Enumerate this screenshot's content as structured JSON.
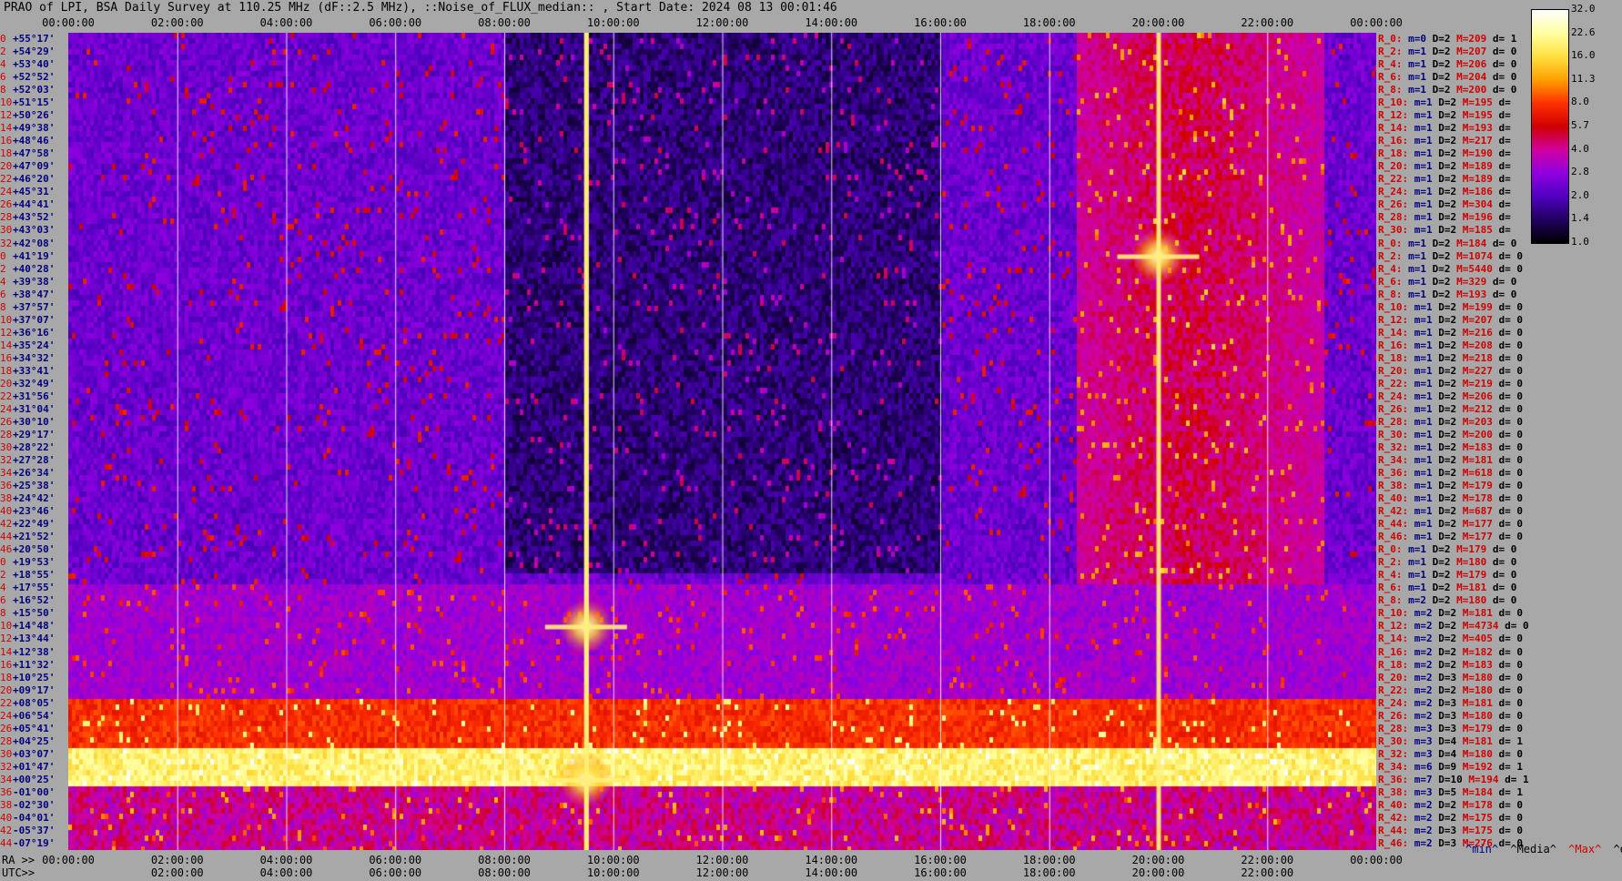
{
  "title": "PRAO of LPI, BSA Daily Survey at 110.25 MHz (dF::2.5 MHz), ::Noise_of_FLUX_median:: , Start Date: 2024 08 13 00:01:46",
  "top_axis_labels": [
    "00:00:00",
    "02:00:00",
    "04:00:00",
    "06:00:00",
    "08:00:00",
    "10:00:00",
    "12:00:00",
    "14:00:00",
    "16:00:00",
    "18:00:00",
    "20:00:00",
    "22:00:00",
    "00:00:00"
  ],
  "bottom_axis_ra_label": "RA >>",
  "bottom_axis_ra_labels": [
    "00:00:00",
    "02:00:00",
    "04:00:00",
    "06:00:00",
    "08:00:00",
    "10:00:00",
    "12:00:00",
    "14:00:00",
    "16:00:00",
    "18:00:00",
    "20:00:00",
    "22:00:00",
    "00:00:00"
  ],
  "bottom_axis_utc_label": "UTC>>",
  "bottom_axis_utc_labels": [
    "02:00:00",
    "04:00:00",
    "06:00:00",
    "08:00:00",
    "10:00:00",
    "12:00:00",
    "14:00:00",
    "16:00:00",
    "18:00:00",
    "20:00:00",
    "22:00:00"
  ],
  "stat_headers": [
    "^min^",
    "^Media^",
    "^Max^",
    "^devia^"
  ],
  "colorbar": {
    "ticks": [
      "32.0",
      "22.6",
      "16.0",
      "11.3",
      "8.0",
      "5.7",
      "4.0",
      "2.8",
      "2.0",
      "1.4",
      "1.0"
    ],
    "colors": [
      "#ffffff",
      "#ffffa0",
      "#ffe040",
      "#ffa000",
      "#ff3000",
      "#d00000",
      "#d000a0",
      "#9000e0",
      "#5000c0",
      "#200060",
      "#000000"
    ]
  },
  "row_labels": [
    {
      "i": "0",
      "dec": "+55°17'"
    },
    {
      "i": "2",
      "dec": "+54°29'"
    },
    {
      "i": "4",
      "dec": "+53°40'"
    },
    {
      "i": "6",
      "dec": "+52°52'"
    },
    {
      "i": "8",
      "dec": "+52°03'"
    },
    {
      "i": "10",
      "dec": "+51°15'"
    },
    {
      "i": "12",
      "dec": "+50°26'"
    },
    {
      "i": "14",
      "dec": "+49°38'"
    },
    {
      "i": "16",
      "dec": "+48°46'"
    },
    {
      "i": "18",
      "dec": "+47°58'"
    },
    {
      "i": "20",
      "dec": "+47°09'"
    },
    {
      "i": "22",
      "dec": "+46°20'"
    },
    {
      "i": "24",
      "dec": "+45°31'"
    },
    {
      "i": "26",
      "dec": "+44°41'"
    },
    {
      "i": "28",
      "dec": "+43°52'"
    },
    {
      "i": "30",
      "dec": "+43°03'"
    },
    {
      "i": "32",
      "dec": "+42°08'"
    },
    {
      "i": "0",
      "dec": "+41°19'"
    },
    {
      "i": "2",
      "dec": "+40°28'"
    },
    {
      "i": "4",
      "dec": "+39°38'"
    },
    {
      "i": "6",
      "dec": "+38°47'"
    },
    {
      "i": "8",
      "dec": "+37°57'"
    },
    {
      "i": "10",
      "dec": "+37°07'"
    },
    {
      "i": "12",
      "dec": "+36°16'"
    },
    {
      "i": "14",
      "dec": "+35°24'"
    },
    {
      "i": "16",
      "dec": "+34°32'"
    },
    {
      "i": "18",
      "dec": "+33°41'"
    },
    {
      "i": "20",
      "dec": "+32°49'"
    },
    {
      "i": "22",
      "dec": "+31°56'"
    },
    {
      "i": "24",
      "dec": "+31°04'"
    },
    {
      "i": "26",
      "dec": "+30°10'"
    },
    {
      "i": "28",
      "dec": "+29°17'"
    },
    {
      "i": "30",
      "dec": "+28°22'"
    },
    {
      "i": "32",
      "dec": "+27°28'"
    },
    {
      "i": "34",
      "dec": "+26°34'"
    },
    {
      "i": "36",
      "dec": "+25°38'"
    },
    {
      "i": "38",
      "dec": "+24°42'"
    },
    {
      "i": "40",
      "dec": "+23°46'"
    },
    {
      "i": "42",
      "dec": "+22°49'"
    },
    {
      "i": "44",
      "dec": "+21°52'"
    },
    {
      "i": "46",
      "dec": "+20°50'"
    },
    {
      "i": "0",
      "dec": "+19°53'"
    },
    {
      "i": "2",
      "dec": "+18°55'"
    },
    {
      "i": "4",
      "dec": "+17°55'"
    },
    {
      "i": "6",
      "dec": "+16°52'"
    },
    {
      "i": "8",
      "dec": "+15°50'"
    },
    {
      "i": "10",
      "dec": "+14°48'"
    },
    {
      "i": "12",
      "dec": "+13°44'"
    },
    {
      "i": "14",
      "dec": "+12°38'"
    },
    {
      "i": "16",
      "dec": "+11°32'"
    },
    {
      "i": "18",
      "dec": "+10°25'"
    },
    {
      "i": "20",
      "dec": "+09°17'"
    },
    {
      "i": "22",
      "dec": "+08°05'"
    },
    {
      "i": "24",
      "dec": "+06°54'"
    },
    {
      "i": "26",
      "dec": "+05°41'"
    },
    {
      "i": "28",
      "dec": "+04°25'"
    },
    {
      "i": "30",
      "dec": "+03°07'"
    },
    {
      "i": "32",
      "dec": "+01°47'"
    },
    {
      "i": "34",
      "dec": "+00°25'"
    },
    {
      "i": "36",
      "dec": "-01°00'"
    },
    {
      "i": "38",
      "dec": "-02°30'"
    },
    {
      "i": "40",
      "dec": "-04°01'"
    },
    {
      "i": "42",
      "dec": "-05°37'"
    },
    {
      "i": "44",
      "dec": "-07°19'"
    }
  ],
  "right_stats": [
    {
      "r": "R_0:",
      "m": "m=0",
      "D": "D=2",
      "M": "M=209",
      "d": "d= 1"
    },
    {
      "r": "R_2:",
      "m": "m=1",
      "D": "D=2",
      "M": "M=207",
      "d": "d= 0"
    },
    {
      "r": "R_4:",
      "m": "m=1",
      "D": "D=2",
      "M": "M=206",
      "d": "d= 0"
    },
    {
      "r": "R_6:",
      "m": "m=1",
      "D": "D=2",
      "M": "M=204",
      "d": "d= 0"
    },
    {
      "r": "R_8:",
      "m": "m=1",
      "D": "D=2",
      "M": "M=200",
      "d": "d= 0"
    },
    {
      "r": "R_10:",
      "m": "m=1",
      "D": "D=2",
      "M": "M=195",
      "d": "d="
    },
    {
      "r": "R_12:",
      "m": "m=1",
      "D": "D=2",
      "M": "M=195",
      "d": "d="
    },
    {
      "r": "R_14:",
      "m": "m=1",
      "D": "D=2",
      "M": "M=193",
      "d": "d="
    },
    {
      "r": "R_16:",
      "m": "m=1",
      "D": "D=2",
      "M": "M=217",
      "d": "d="
    },
    {
      "r": "R_18:",
      "m": "m=1",
      "D": "D=2",
      "M": "M=190",
      "d": "d="
    },
    {
      "r": "R_20:",
      "m": "m=1",
      "D": "D=2",
      "M": "M=189",
      "d": "d="
    },
    {
      "r": "R_22:",
      "m": "m=1",
      "D": "D=2",
      "M": "M=189",
      "d": "d="
    },
    {
      "r": "R_24:",
      "m": "m=1",
      "D": "D=2",
      "M": "M=186",
      "d": "d="
    },
    {
      "r": "R_26:",
      "m": "m=1",
      "D": "D=2",
      "M": "M=304",
      "d": "d="
    },
    {
      "r": "R_28:",
      "m": "m=1",
      "D": "D=2",
      "M": "M=196",
      "d": "d="
    },
    {
      "r": "R_30:",
      "m": "m=1",
      "D": "D=2",
      "M": "M=185",
      "d": "d="
    },
    {
      "r": "R_0:",
      "m": "m=1",
      "D": "D=2",
      "M": "M=184",
      "d": "d= 0"
    },
    {
      "r": "R_2:",
      "m": "m=1",
      "D": "D=2",
      "M": "M=1074",
      "d": "d= 0"
    },
    {
      "r": "R_4:",
      "m": "m=1",
      "D": "D=2",
      "M": "M=5440",
      "d": "d= 0"
    },
    {
      "r": "R_6:",
      "m": "m=1",
      "D": "D=2",
      "M": "M=329",
      "d": "d= 0"
    },
    {
      "r": "R_8:",
      "m": "m=1",
      "D": "D=2",
      "M": "M=193",
      "d": "d= 0"
    },
    {
      "r": "R_10:",
      "m": "m=1",
      "D": "D=2",
      "M": "M=199",
      "d": "d= 0"
    },
    {
      "r": "R_12:",
      "m": "m=1",
      "D": "D=2",
      "M": "M=207",
      "d": "d= 0"
    },
    {
      "r": "R_14:",
      "m": "m=1",
      "D": "D=2",
      "M": "M=216",
      "d": "d= 0"
    },
    {
      "r": "R_16:",
      "m": "m=1",
      "D": "D=2",
      "M": "M=208",
      "d": "d= 0"
    },
    {
      "r": "R_18:",
      "m": "m=1",
      "D": "D=2",
      "M": "M=218",
      "d": "d= 0"
    },
    {
      "r": "R_20:",
      "m": "m=1",
      "D": "D=2",
      "M": "M=227",
      "d": "d= 0"
    },
    {
      "r": "R_22:",
      "m": "m=1",
      "D": "D=2",
      "M": "M=219",
      "d": "d= 0"
    },
    {
      "r": "R_24:",
      "m": "m=1",
      "D": "D=2",
      "M": "M=206",
      "d": "d= 0"
    },
    {
      "r": "R_26:",
      "m": "m=1",
      "D": "D=2",
      "M": "M=212",
      "d": "d= 0"
    },
    {
      "r": "R_28:",
      "m": "m=1",
      "D": "D=2",
      "M": "M=203",
      "d": "d= 0"
    },
    {
      "r": "R_30:",
      "m": "m=1",
      "D": "D=2",
      "M": "M=200",
      "d": "d= 0"
    },
    {
      "r": "R_32:",
      "m": "m=1",
      "D": "D=2",
      "M": "M=183",
      "d": "d= 0"
    },
    {
      "r": "R_34:",
      "m": "m=1",
      "D": "D=2",
      "M": "M=181",
      "d": "d= 0"
    },
    {
      "r": "R_36:",
      "m": "m=1",
      "D": "D=2",
      "M": "M=618",
      "d": "d= 0"
    },
    {
      "r": "R_38:",
      "m": "m=1",
      "D": "D=2",
      "M": "M=179",
      "d": "d= 0"
    },
    {
      "r": "R_40:",
      "m": "m=1",
      "D": "D=2",
      "M": "M=178",
      "d": "d= 0"
    },
    {
      "r": "R_42:",
      "m": "m=1",
      "D": "D=2",
      "M": "M=687",
      "d": "d= 0"
    },
    {
      "r": "R_44:",
      "m": "m=1",
      "D": "D=2",
      "M": "M=177",
      "d": "d= 0"
    },
    {
      "r": "R_46:",
      "m": "m=1",
      "D": "D=2",
      "M": "M=177",
      "d": "d= 0"
    },
    {
      "r": "R_0:",
      "m": "m=1",
      "D": "D=2",
      "M": "M=179",
      "d": "d= 0"
    },
    {
      "r": "R_2:",
      "m": "m=1",
      "D": "D=2",
      "M": "M=180",
      "d": "d= 0"
    },
    {
      "r": "R_4:",
      "m": "m=1",
      "D": "D=2",
      "M": "M=179",
      "d": "d= 0"
    },
    {
      "r": "R_6:",
      "m": "m=1",
      "D": "D=2",
      "M": "M=181",
      "d": "d= 0"
    },
    {
      "r": "R_8:",
      "m": "m=2",
      "D": "D=2",
      "M": "M=180",
      "d": "d= 0"
    },
    {
      "r": "R_10:",
      "m": "m=2",
      "D": "D=2",
      "M": "M=181",
      "d": "d= 0"
    },
    {
      "r": "R_12:",
      "m": "m=2",
      "D": "D=2",
      "M": "M=4734",
      "d": "d= 0"
    },
    {
      "r": "R_14:",
      "m": "m=2",
      "D": "D=2",
      "M": "M=405",
      "d": "d= 0"
    },
    {
      "r": "R_16:",
      "m": "m=2",
      "D": "D=2",
      "M": "M=182",
      "d": "d= 0"
    },
    {
      "r": "R_18:",
      "m": "m=2",
      "D": "D=2",
      "M": "M=183",
      "d": "d= 0"
    },
    {
      "r": "R_20:",
      "m": "m=2",
      "D": "D=3",
      "M": "M=180",
      "d": "d= 0"
    },
    {
      "r": "R_22:",
      "m": "m=2",
      "D": "D=2",
      "M": "M=180",
      "d": "d= 0"
    },
    {
      "r": "R_24:",
      "m": "m=2",
      "D": "D=3",
      "M": "M=181",
      "d": "d= 0"
    },
    {
      "r": "R_26:",
      "m": "m=2",
      "D": "D=3",
      "M": "M=180",
      "d": "d= 0"
    },
    {
      "r": "R_28:",
      "m": "m=3",
      "D": "D=3",
      "M": "M=179",
      "d": "d= 0"
    },
    {
      "r": "R_30:",
      "m": "m=3",
      "D": "D=4",
      "M": "M=181",
      "d": "d= 1"
    },
    {
      "r": "R_32:",
      "m": "m=3",
      "D": "D=4",
      "M": "M=180",
      "d": "d= 0"
    },
    {
      "r": "R_34:",
      "m": "m=6",
      "D": "D=9",
      "M": "M=192",
      "d": "d= 1"
    },
    {
      "r": "R_36:",
      "m": "m=7",
      "D": "D=10",
      "M": "M=194",
      "d": "d= 1"
    },
    {
      "r": "R_38:",
      "m": "m=3",
      "D": "D=5",
      "M": "M=184",
      "d": "d= 1"
    },
    {
      "r": "R_40:",
      "m": "m=2",
      "D": "D=2",
      "M": "M=178",
      "d": "d= 0"
    },
    {
      "r": "R_42:",
      "m": "m=2",
      "D": "D=2",
      "M": "M=175",
      "d": "d= 0"
    },
    {
      "r": "R_44:",
      "m": "m=2",
      "D": "D=3",
      "M": "M=175",
      "d": "d= 0"
    },
    {
      "r": "R_46:",
      "m": "m=2",
      "D": "D=3",
      "M": "M=276",
      "d": "d= 0"
    }
  ],
  "chart_data": {
    "type": "heatmap",
    "title": "PRAO of LPI, BSA Daily Survey at 110.25 MHz (dF::2.5 MHz), ::Noise_of_FLUX_median:: , Start Date: 2024 08 13 00:01:46",
    "x": {
      "unit": "hours",
      "range": [
        0,
        24
      ],
      "ticks": [
        0,
        2,
        4,
        6,
        8,
        10,
        12,
        14,
        16,
        18,
        20,
        22,
        24
      ]
    },
    "y": {
      "unit": "declination (deg)",
      "range": [
        55.3,
        -7.3
      ],
      "rows": 64
    },
    "color_scale": {
      "type": "log",
      "range": [
        1.0,
        32.0
      ],
      "ticks": [
        32.0,
        22.6,
        16.0,
        11.3,
        8.0,
        5.7,
        4.0,
        2.8,
        2.0,
        1.4,
        1.0
      ]
    },
    "bright_band_rows": [
      56,
      57,
      58
    ],
    "vertical_lines_hours": [
      2.0,
      4.0,
      6.0,
      8.0,
      10.0,
      12.0,
      14.0,
      16.0,
      18.0,
      20.0,
      22.0
    ],
    "sources": [
      {
        "hour": 20.0,
        "row": 17,
        "value": 32.0
      },
      {
        "hour": 9.5,
        "row": 46,
        "value": 32.0
      },
      {
        "hour": 9.5,
        "row": 58,
        "value": 22.6
      }
    ],
    "grid": false
  }
}
